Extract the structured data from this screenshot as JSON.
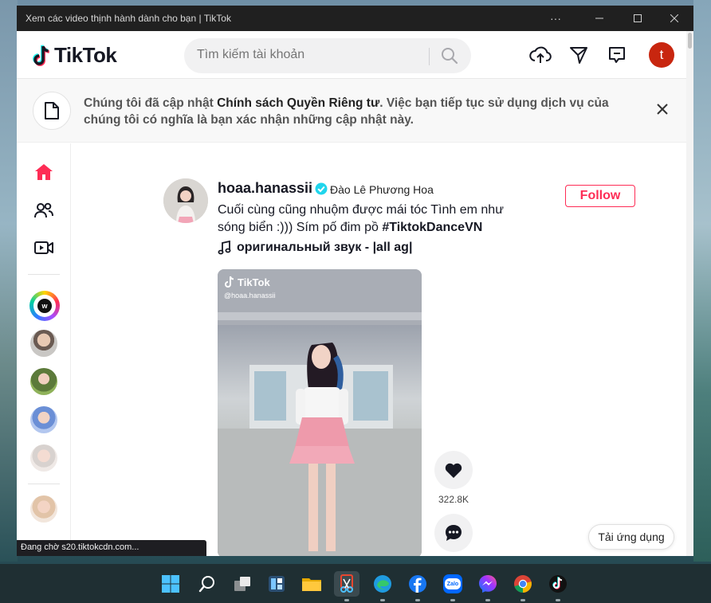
{
  "window": {
    "title": "Xem các video thịnh hành dành cho bạn | TikTok",
    "more_label": "···",
    "minimize_label": "—",
    "maximize_label": "☐",
    "close_label": "✕"
  },
  "header": {
    "logo_text": "TikTok",
    "search_placeholder": "Tìm kiếm tài khoản",
    "user_initial": "t",
    "icons": [
      "upload-icon",
      "send-icon",
      "inbox-icon",
      "search-icon"
    ]
  },
  "notice": {
    "text_before": "Chúng tôi đã cập nhật ",
    "link": "Chính sách Quyền Riêng tư",
    "text_after": ". Việc bạn tiếp tục sử dụng dịch vụ của chúng tôi có nghĩa là bạn xác nhận những cập nhật này."
  },
  "sidebar": {
    "icons": [
      "home-icon",
      "following-icon",
      "live-icon"
    ],
    "accent": "#fe2c55"
  },
  "post": {
    "username": "hoaa.hanassii",
    "nickname": "Đào Lê Phương Hoa",
    "caption_text": "Cuối cùng cũng nhuộm được mái tóc Tình em như sóng biển :))) Sím pố đim pồ ",
    "hashtag": "#TiktokDanceVN",
    "music": "оригинальный звук - |all ag|",
    "follow_label": "Follow",
    "video_watermark": "TikTok",
    "video_user": "@hoaa.hanassii",
    "like_count": "322.8K"
  },
  "get_app_label": "Tải ứng dụng",
  "status_text": "Đang chờ s20.tiktokcdn.com...",
  "taskbar": {
    "apps": [
      "start-icon",
      "search-icon",
      "task-view-icon",
      "widgets-icon",
      "file-explorer-icon",
      "snipping-tool-icon",
      "edge-icon",
      "facebook-icon",
      "zalo-icon",
      "messenger-icon",
      "chrome-icon",
      "tiktok-icon"
    ],
    "zalo_label": "Zalo"
  }
}
